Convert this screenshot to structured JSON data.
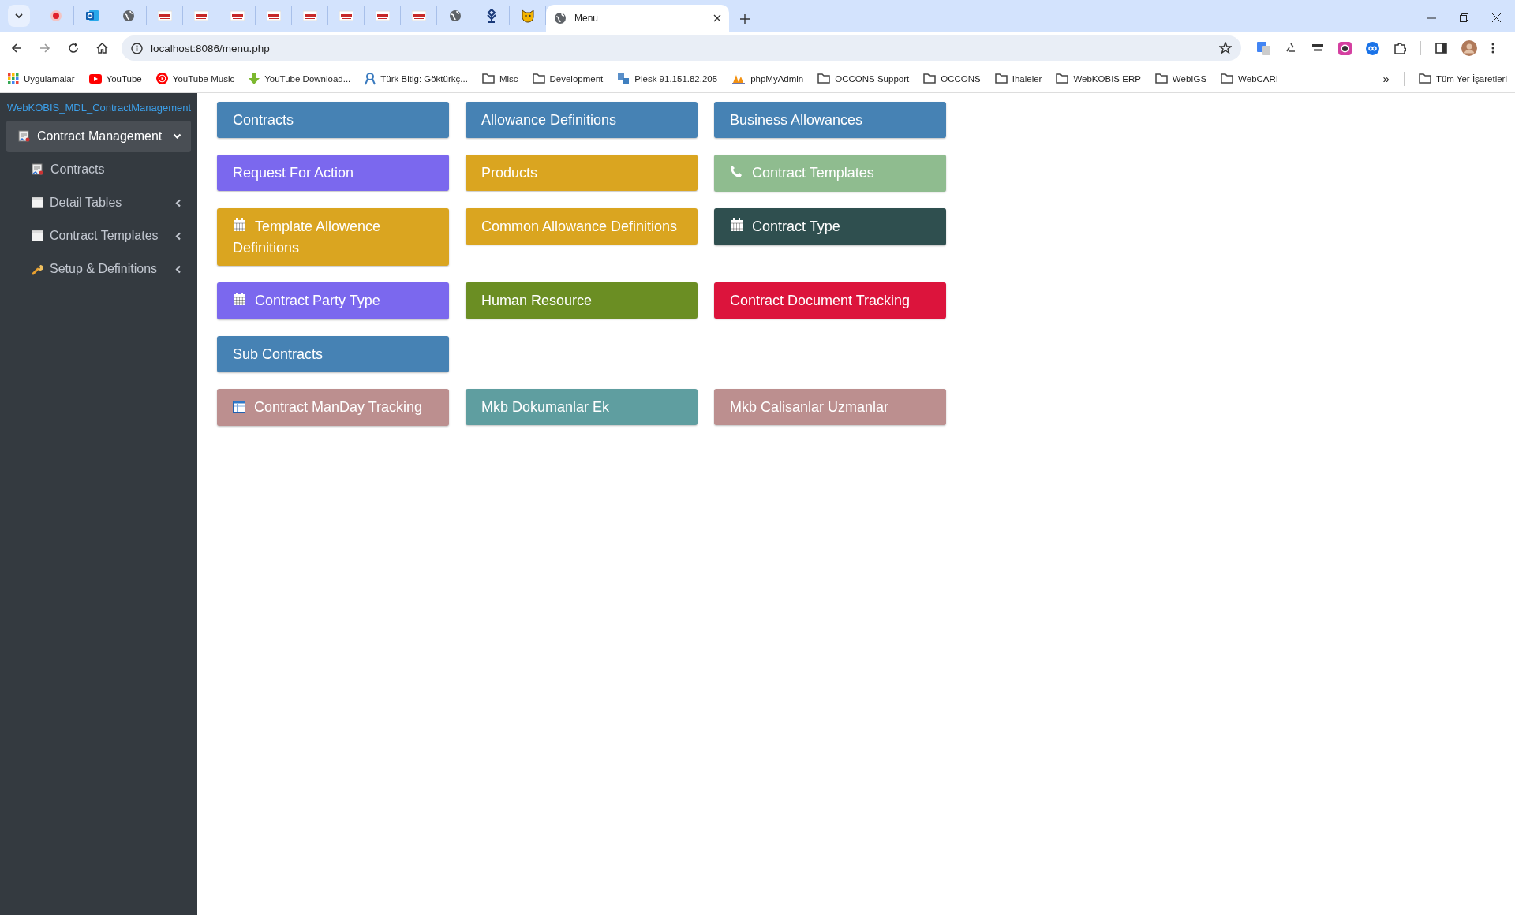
{
  "browser": {
    "tabs": [
      {
        "kind": "record",
        "selected": false
      },
      {
        "kind": "mail",
        "selected": false
      },
      {
        "kind": "globe",
        "selected": false
      },
      {
        "kind": "brand",
        "selected": false
      },
      {
        "kind": "brand",
        "selected": false
      },
      {
        "kind": "brand",
        "selected": false
      },
      {
        "kind": "brand",
        "selected": false
      },
      {
        "kind": "brand",
        "selected": false
      },
      {
        "kind": "brand",
        "selected": false
      },
      {
        "kind": "brand",
        "selected": false
      },
      {
        "kind": "brand",
        "selected": false
      },
      {
        "kind": "globe",
        "selected": false
      },
      {
        "kind": "tree",
        "selected": false
      },
      {
        "kind": "cat",
        "selected": false
      },
      {
        "kind": "globe",
        "selected": true,
        "title": "Menu"
      }
    ],
    "address": "localhost:8086/menu.php",
    "bookmarks": [
      {
        "kind": "apps",
        "label": "Uygulamalar"
      },
      {
        "kind": "youtube",
        "label": "YouTube"
      },
      {
        "kind": "music",
        "label": "YouTube Music"
      },
      {
        "kind": "download",
        "label": "YouTube Download..."
      },
      {
        "kind": "ribbon",
        "label": "Türk Bitig: Göktürkç..."
      },
      {
        "kind": "folder",
        "label": "Misc"
      },
      {
        "kind": "folder",
        "label": "Development"
      },
      {
        "kind": "plesk",
        "label": "Plesk 91.151.82.205"
      },
      {
        "kind": "pma",
        "label": "phpMyAdmin"
      },
      {
        "kind": "folder",
        "label": "OCCONS Support"
      },
      {
        "kind": "folder",
        "label": "OCCONS"
      },
      {
        "kind": "folder",
        "label": "Ihaleler"
      },
      {
        "kind": "folder",
        "label": "WebKOBIS ERP"
      },
      {
        "kind": "folder",
        "label": "WebIGS"
      },
      {
        "kind": "folder",
        "label": "WebCARI"
      }
    ],
    "more_bookmarks": "»",
    "all_bookmarks": "Tüm Yer İşaretleri"
  },
  "sidebar": {
    "title": "WebKOBIS_MDL_ContractManagement",
    "items": [
      {
        "label": "Contract Management",
        "kind": "contract",
        "selected": true,
        "expanded": true,
        "children": [
          {
            "label": "Contracts",
            "kind": "contract",
            "selected": false
          },
          {
            "label": "Detail Tables",
            "kind": "table",
            "selected": false,
            "expanded": false
          },
          {
            "label": "Contract Templates",
            "kind": "table",
            "selected": false,
            "expanded": false
          },
          {
            "label": "Setup & Definitions",
            "kind": "wrench",
            "selected": false,
            "expanded": false
          }
        ]
      }
    ]
  },
  "tile_rows": [
    [
      {
        "label": "Contracts",
        "color": "#4682b4"
      },
      {
        "label": "Allowance Definitions",
        "color": "#4682b4"
      },
      {
        "label": "Business Allowances",
        "color": "#4682b4"
      }
    ],
    [
      {
        "label": "Request For Action",
        "color": "#7b68ee"
      },
      {
        "label": "Products",
        "color": "#daa520"
      },
      {
        "label": "Contract Templates",
        "color": "#8fbc8f",
        "kind": "phone"
      }
    ],
    [
      {
        "label": "Template Allowence Definitions",
        "color": "#daa520",
        "kind": "calendar"
      },
      {
        "label": "Common Allowance Definitions",
        "color": "#daa520"
      },
      {
        "label": "Contract Type",
        "color": "#2f4f4f",
        "kind": "calendar"
      }
    ],
    [
      {
        "label": "Contract Party Type",
        "color": "#7b68ee",
        "kind": "calendar"
      },
      {
        "label": "Human Resource",
        "color": "#6b8e23"
      },
      {
        "label": "Contract Document Tracking",
        "color": "#dc143c"
      }
    ],
    [
      {
        "label": "Sub Contracts",
        "color": "#4682b4"
      }
    ],
    [
      {
        "label": "Contract ManDay Tracking",
        "color": "#bc8f8f",
        "kind": "table"
      },
      {
        "label": "Mkb Dokumanlar Ek",
        "color": "#5f9ea0"
      },
      {
        "label": "Mkb Calisanlar Uzmanlar",
        "color": "#bc8f8f"
      }
    ]
  ]
}
